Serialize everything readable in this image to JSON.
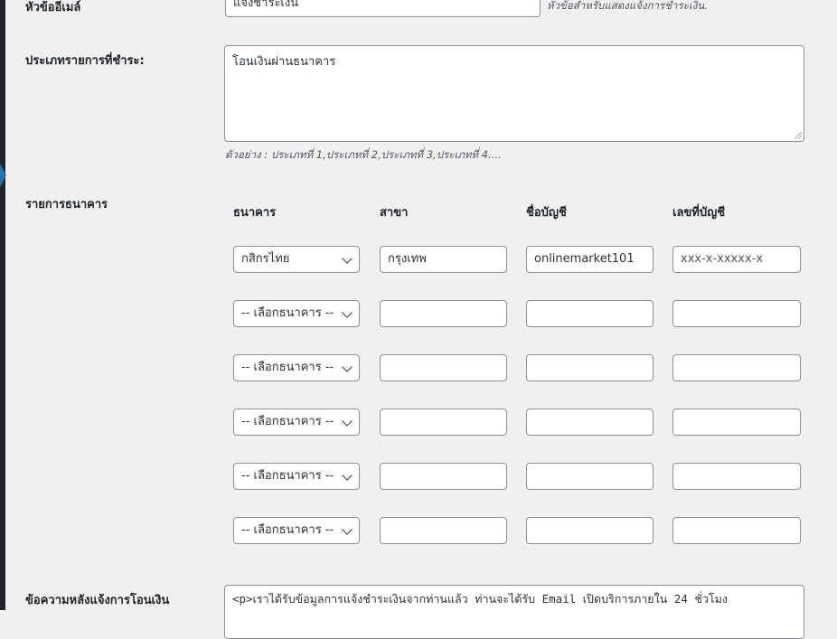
{
  "email_subject": {
    "label": "หัวข้ออีเมล์",
    "value": "แจ้งชำระเงิน",
    "description": "หัวข้อสำหรับแสดงแจ้งการชำระเงิน."
  },
  "payment_types": {
    "label": "ประเภทรายการที่ชำระ:",
    "value": "โอนเงินผ่านธนาคาร",
    "description": "ตัวอย่าง : ประเภทที่ 1,ประเภทที่ 2,ประเภทที่ 3,ประเภทที่ 4...."
  },
  "bank_list": {
    "label": "รายการธนาคาร",
    "headers": [
      "ธนาคาร",
      "สาขา",
      "ชื่อบัญชี",
      "เลขที่บัญชี"
    ],
    "rows": [
      {
        "bank": "กสิกรไทย",
        "branch": "กรุงเทพ",
        "account_name": "onlinemarket101",
        "account_number": "xxx-x-xxxxx-x"
      },
      {
        "bank": "-- เลือกธนาคาร --",
        "branch": "",
        "account_name": "",
        "account_number": ""
      },
      {
        "bank": "-- เลือกธนาคาร --",
        "branch": "",
        "account_name": "",
        "account_number": ""
      },
      {
        "bank": "-- เลือกธนาคาร --",
        "branch": "",
        "account_name": "",
        "account_number": ""
      },
      {
        "bank": "-- เลือกธนาคาร --",
        "branch": "",
        "account_name": "",
        "account_number": ""
      },
      {
        "bank": "-- เลือกธนาคาร --",
        "branch": "",
        "account_name": "",
        "account_number": ""
      }
    ]
  },
  "after_transfer_message": {
    "label": "ข้อความหลังแจ้งการโอนเงิน",
    "value": "<p>เราได้รับข้อมูลการแจ้งชำระเงินจากท่านแล้ว ท่านจะได้รับ Email เปิดบริการภายใน 24 ชั่วโมง"
  }
}
